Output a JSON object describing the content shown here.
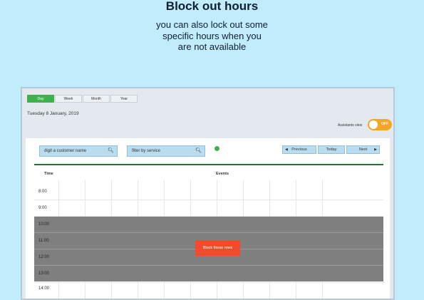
{
  "header": {
    "title": "Block out hours",
    "subtitle_lines": [
      "you can also lock out some",
      "specific hours when you",
      "are not available"
    ]
  },
  "calendar": {
    "view_tabs": [
      {
        "label": "Day",
        "active": true
      },
      {
        "label": "Week",
        "active": false
      },
      {
        "label": "Month",
        "active": false
      },
      {
        "label": "Year",
        "active": false
      }
    ],
    "date": "Tuesday 8 January, 2019",
    "assistants_view": {
      "label": "Assistants view",
      "toggle_text": "OFF"
    },
    "search": {
      "customer_placeholder": "digit a customer name",
      "service_placeholder": "filter by service"
    },
    "nav": {
      "previous": "Previous",
      "today": "Today",
      "next": "Next"
    },
    "columns": {
      "time": "Time",
      "events": "Events"
    },
    "times": [
      "8:00",
      "9:00",
      "10:00",
      "11:00",
      "12:00",
      "13:00",
      "14:00"
    ],
    "blocked_times": [
      "10:00",
      "11:00",
      "12:00",
      "13:00"
    ],
    "block_button": "Block these rows"
  },
  "colors": {
    "page_bg": "#c1ecfb",
    "accent_green": "#3fb04c",
    "toggle": "#f5a623",
    "block_button": "#f24a2b",
    "blocked_rows": "#7f7f7f"
  }
}
